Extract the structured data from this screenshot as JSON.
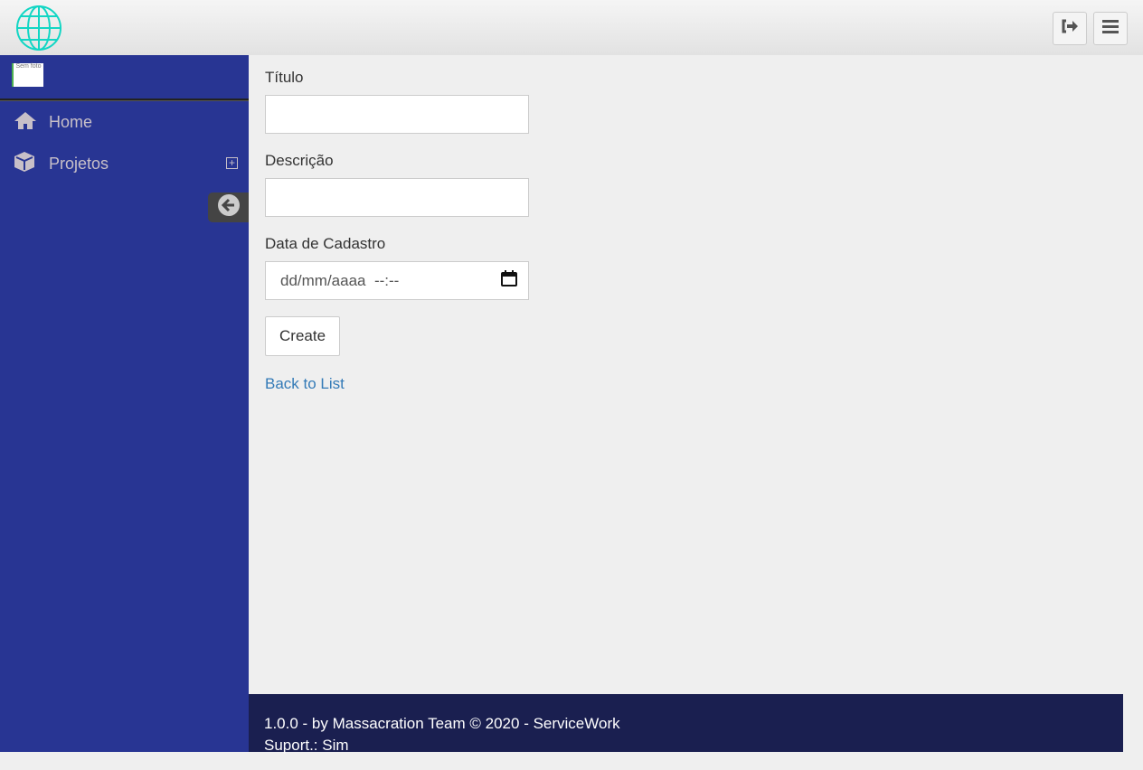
{
  "header": {
    "logo": "globe-logo",
    "logout_icon": "sign-out-icon",
    "menu_icon": "bars-icon"
  },
  "sidebar": {
    "photo_text": "Sem foto",
    "items": [
      {
        "label": "Home",
        "icon": "home-icon"
      },
      {
        "label": "Projetos",
        "icon": "cube-icon"
      }
    ]
  },
  "form": {
    "titulo_label": "Título",
    "descricao_label": "Descrição",
    "data_label": "Data de Cadastro",
    "data_placeholder": "dd/mm/aaaa  --:--",
    "create_label": "Create",
    "back_label": "Back to List"
  },
  "footer": {
    "line1": "1.0.0 - by Massacration Team © 2020 - ServiceWork",
    "line2": "Suport.: Sim"
  },
  "colors": {
    "sidebar": "#283593",
    "footer": "#1a1f50",
    "link": "#337ab7",
    "logo": "#00d4c0"
  }
}
